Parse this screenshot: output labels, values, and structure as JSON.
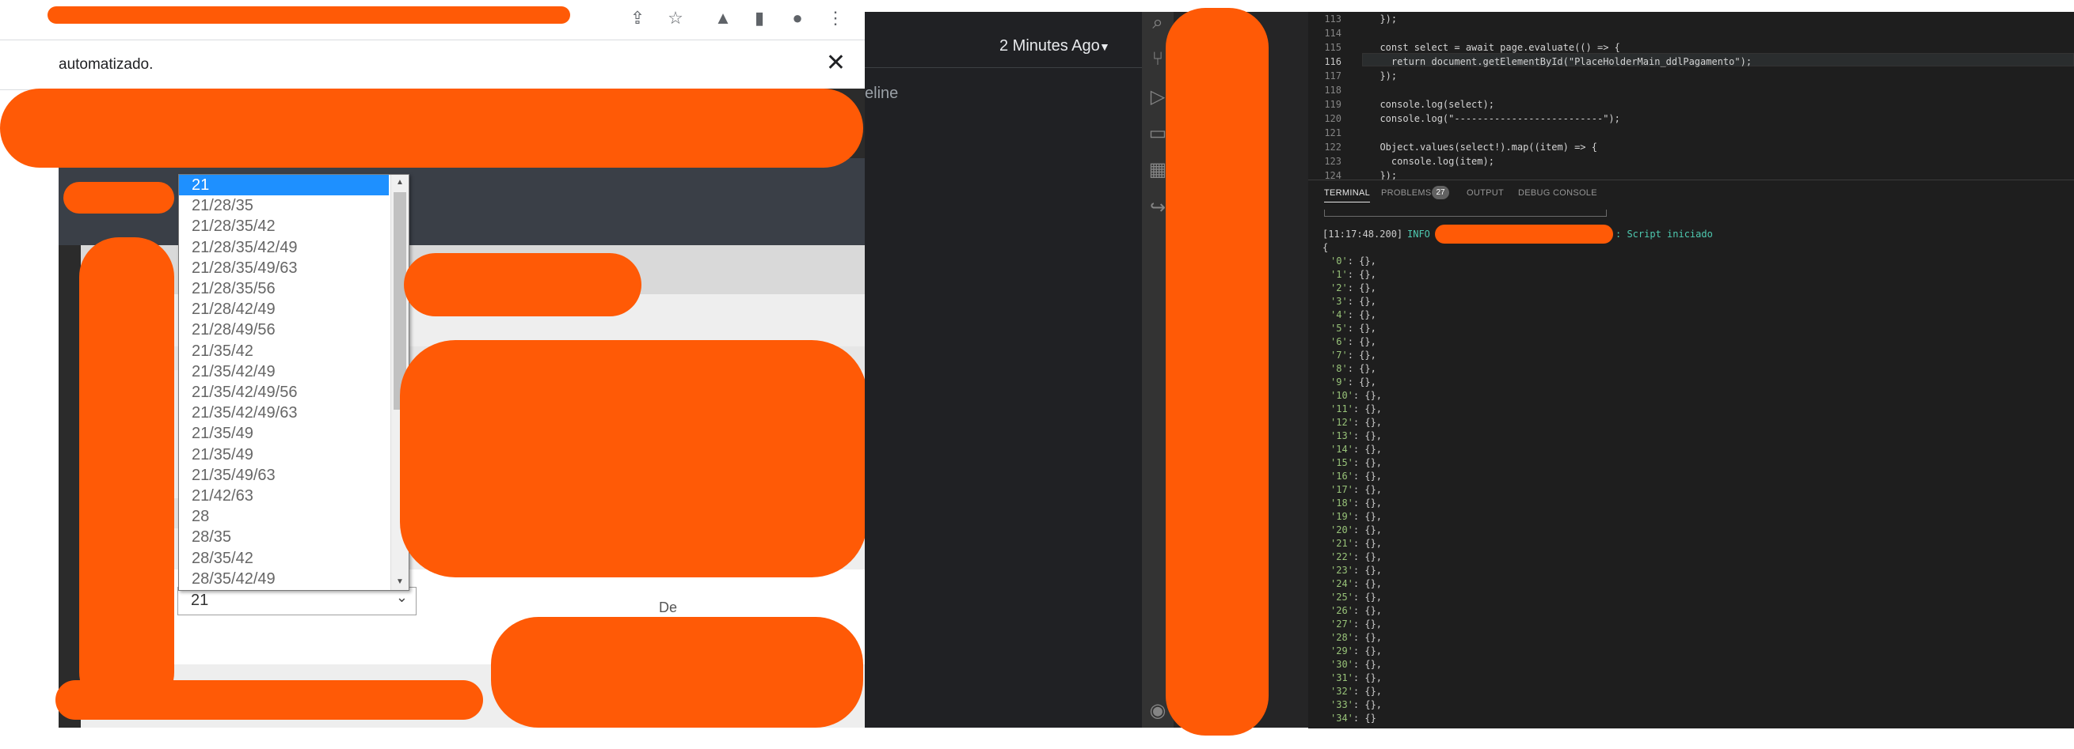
{
  "browser": {
    "infobar_text": "automatizado.",
    "close_glyph": "✕",
    "toolbar_icons": [
      "share-icon",
      "star-icon",
      "extensions-icon",
      "reading-list-icon",
      "profile-icon",
      "menu-icon"
    ]
  },
  "page": {
    "select_value": "21",
    "side_label": "De",
    "dropdown_options": [
      "21",
      "21/28/35",
      "21/28/35/42",
      "21/28/35/42/49",
      "21/28/35/49/63",
      "21/28/35/56",
      "21/28/42/49",
      "21/28/49/56",
      "21/35/42",
      "21/35/42/49",
      "21/35/42/49/56",
      "21/35/42/49/63",
      "21/35/49",
      "21/35/49",
      "21/35/49/63",
      "21/42/63",
      "28",
      "28/35",
      "28/35/42",
      "28/35/42/49"
    ],
    "selected_index": 0
  },
  "middle": {
    "time_label": "2 Minutes Ago",
    "timeline_label": "eline"
  },
  "editor": {
    "lines": [
      {
        "n": "113",
        "code": "  });"
      },
      {
        "n": "114",
        "code": ""
      },
      {
        "n": "115",
        "code": "  const select = await page.evaluate(() => {"
      },
      {
        "n": "116",
        "code": "    return document.getElementById(\"PlaceHolderMain_ddlPagamento\");"
      },
      {
        "n": "117",
        "code": "  });"
      },
      {
        "n": "118",
        "code": ""
      },
      {
        "n": "119",
        "code": "  console.log(select);"
      },
      {
        "n": "120",
        "code": "  console.log(\"--------------------------\");"
      },
      {
        "n": "121",
        "code": ""
      },
      {
        "n": "122",
        "code": "  Object.values(select!).map((item) => {"
      },
      {
        "n": "123",
        "code": "    console.log(item);"
      },
      {
        "n": "124",
        "code": "  });"
      }
    ],
    "active_line": "116"
  },
  "panel": {
    "tabs": [
      "TERMINAL",
      "PROBLEMS",
      "OUTPUT",
      "DEBUG CONSOLE"
    ],
    "problems_count": "27",
    "log_time": "[11:17:48.200]",
    "log_level": "INFO",
    "log_message": ": Script iniciado",
    "open_brace": "{",
    "entries_count": 35
  },
  "colors": {
    "scribble": "#ff5a06",
    "selected_option": "#1e90ff",
    "terminal_key": "#98c379",
    "info": "#4ec9b0"
  }
}
